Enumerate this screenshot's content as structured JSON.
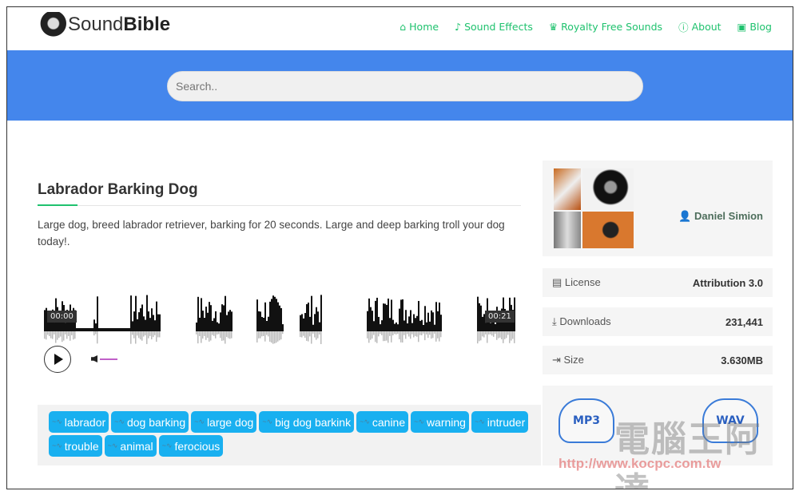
{
  "header": {
    "logo_prefix": "Sound",
    "logo_bold": "Bible",
    "nav": [
      {
        "icon": "home-icon",
        "glyph": "⌂",
        "label": "Home"
      },
      {
        "icon": "sound-effects-icon",
        "glyph": "♪",
        "label": "Sound Effects"
      },
      {
        "icon": "crown-icon",
        "glyph": "♛",
        "label": "Royalty Free Sounds"
      },
      {
        "icon": "info-icon",
        "glyph": "ⓘ",
        "label": "About"
      },
      {
        "icon": "blog-icon",
        "glyph": "▣",
        "label": "Blog"
      }
    ]
  },
  "search": {
    "placeholder": "Search.."
  },
  "sound": {
    "title": "Labrador Barking Dog",
    "description": "Large dog, breed labrador retriever, barking for 20 seconds. Large and deep barking troll your dog today!.",
    "player": {
      "start_time": "00:00",
      "end_time": "00:21",
      "volume_color": "#c060c8"
    },
    "tags": [
      "labrador",
      "dog barking",
      "large dog",
      "big dog barkink",
      "canine",
      "warning",
      "intruder",
      "trouble",
      "animal",
      "ferocious"
    ]
  },
  "sidebar": {
    "author": "Daniel Simion",
    "license_label": "License",
    "license_value": "Attribution 3.0",
    "downloads_label": "Downloads",
    "downloads_value": "231,441",
    "size_label": "Size",
    "size_value": "3.630MB",
    "mp3_label": "MP3",
    "wav_label": "WAV"
  },
  "watermark": {
    "text_cn": "電腦王阿達",
    "url": "http://www.kocpc.com.tw"
  },
  "colors": {
    "accent_green": "#1fc26e",
    "band_blue": "#4486ec",
    "tag_blue": "#19b0f0"
  }
}
